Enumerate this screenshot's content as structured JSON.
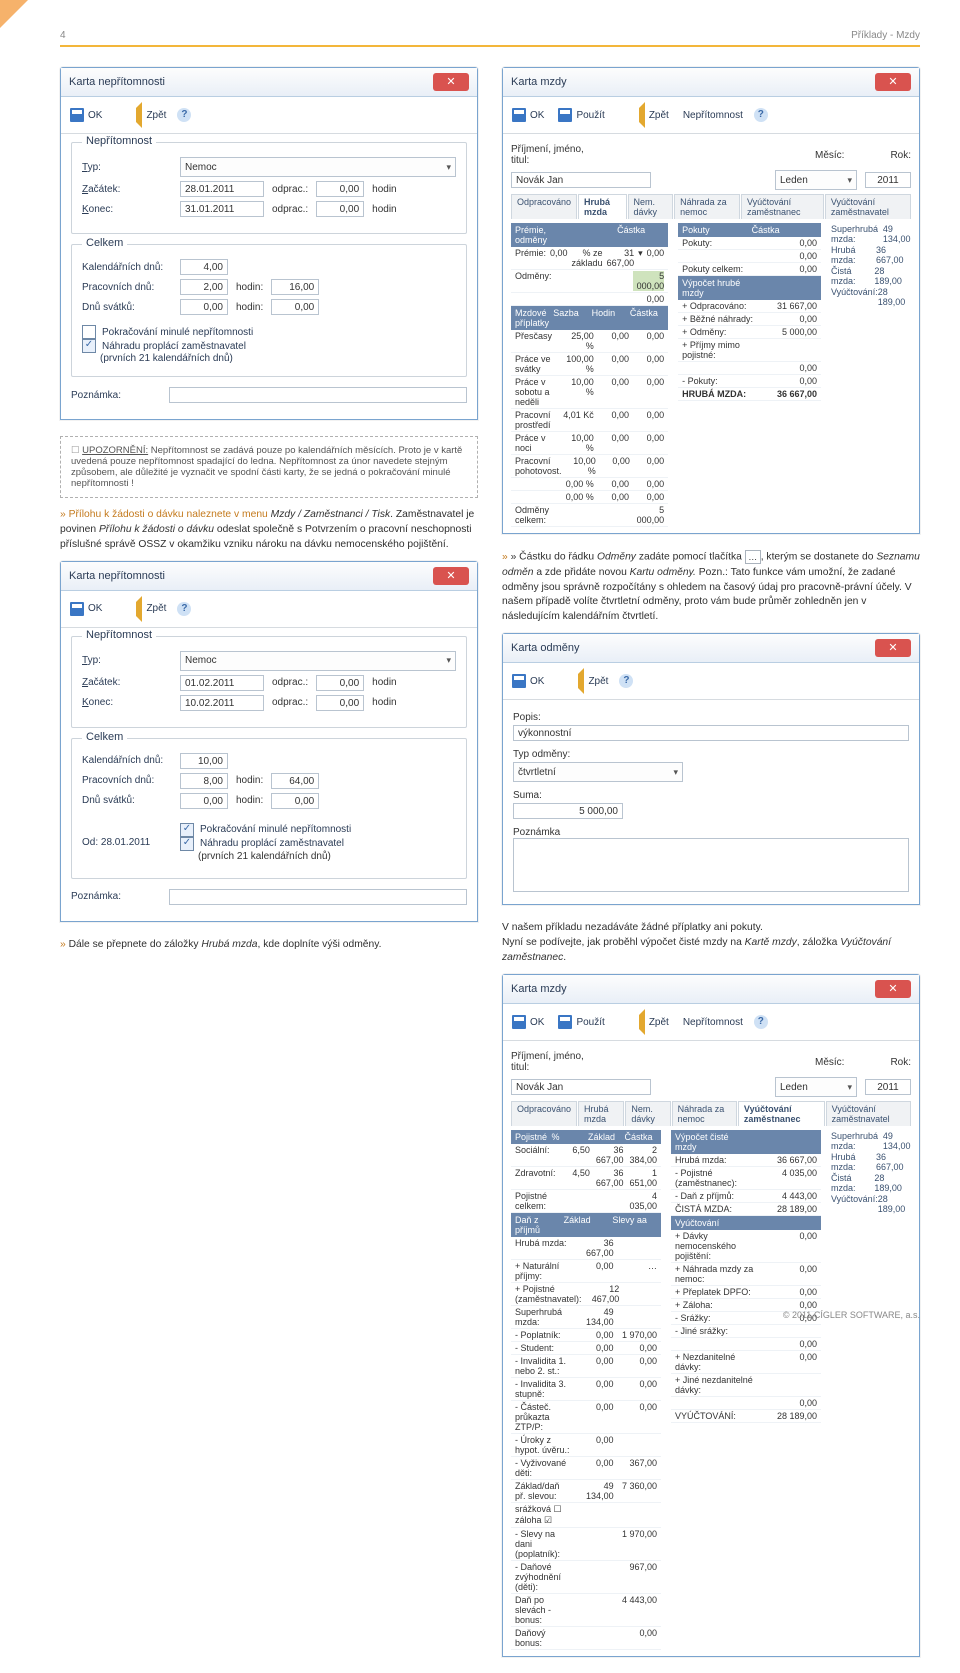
{
  "page": {
    "number": "4",
    "header_right": "Příklady - Mzdy"
  },
  "buttons": {
    "ok": "OK",
    "zpet": "Zpět",
    "pouzit": "Použít",
    "nepritomnost": "Nepřítomnost",
    "help": "?"
  },
  "win1": {
    "title": "Karta nepřítomnosti",
    "group1": "Nepřítomnost",
    "typ_label": "Typ:",
    "typ_value": "Nemoc",
    "zacatek_label": "Začátek:",
    "zacatek": "28.01.2011",
    "odprac": "odprac.:",
    "zacatek_h": "0,00",
    "hodin": "hodin",
    "konec_label": "Konec:",
    "konec": "31.01.2011",
    "konec_h": "0,00",
    "group2": "Celkem",
    "kaldnu_l": "Kalendářních dnů:",
    "kaldnu": "4,00",
    "pracdnu_l": "Pracovních dnů:",
    "pracdnu": "2,00",
    "hodin_l": "hodin:",
    "prach": "16,00",
    "svatku_l": "Dnů svátků:",
    "svatku": "0,00",
    "svh": "0,00",
    "chk1": "Pokračování minulé nepřítomnosti",
    "chk2": "Náhradu proplácí zaměstnavatel",
    "chk2_note": "(prvních 21 kalendářních dnů)",
    "poznamka_l": "Poznámka:"
  },
  "win2": {
    "title": "Karta nepřítomnosti",
    "zacatek": "01.02.2011",
    "konec": "10.02.2011",
    "zacatek_h": "0,00",
    "konec_h": "0,00",
    "kaldnu": "10,00",
    "pracdnu": "8,00",
    "prach": "64,00",
    "svatku": "0,00",
    "svh": "0,00",
    "od_l": "Od: 28.01.2011"
  },
  "body": {
    "upo_lead": "UPOZORNĚNÍ:",
    "upo_rest": " Nepřítomnost se zadává pouze po kalendářních měsících. Proto je v kartě uvedená pouze nepřítomnost spadající do ledna. Nepřítomnost za únor navedete stejným způsobem, ale důležité je vyznačit ve spodní části karty, že se jedná o ",
    "upo_link": "pokračování minulé nepřítomnosti",
    "upo_tail": "!",
    "para1a": "» Přílohu k žádosti o dávku naleznete v menu ",
    "para1b": "Mzdy / Zaměstnanci / Tisk",
    "para1c": ". Zaměstnavatel je povinen ",
    "para1d": "Přílohu k žádosti o dávku",
    "para1e": " odeslat společně s Potvrzením o pracovní neschopnosti příslušné správě OSSZ v okamžiku vzniku nároku na dávku nemocenského pojištění.",
    "para2": "» Dále se přepnete do záložky Hrubá mzda, kde doplníte výši odměny.",
    "para3a": "» Částku do řádku ",
    "para3b": "Odměny",
    "para3c": " zadáte pomocí tlačítka ",
    "para3d": ", kterým se dostanete do ",
    "para3e": "Seznamu odměn",
    "para3f": " a zde přidáte novou ",
    "para3g": "Kartu odměny.",
    "para3h": " Pozn.: Tato funkce vám umožní, že zadané odměny jsou správně rozpočítány s ohledem na časový údaj pro pracovně-právní účely. V našem případě volíte čtvrtletní odměny, proto vám bude průměr zohledněn jen v následujícím kalendářním čtvrtletí.",
    "para4a": "V našem příkladu nezadáváte žádné příplatky ani pokuty.",
    "para4b": "Nyní se podívejte, jak proběhl výpočet čisté mzdy na ",
    "para4c": "Kartě mzdy",
    "para4d": ", záložka ",
    "para4e": "Vyúčtování zaměstnanec",
    "para4f": "."
  },
  "mzdy1": {
    "title": "Karta mzdy",
    "name_l": "Příjmení, jméno, titul:",
    "name": "Novák Jan",
    "mesic_l": "Měsíc:",
    "mesic": "Leden",
    "rok_l": "Rok:",
    "rok": "2011",
    "tabs": [
      "Odpracováno",
      "Hrubá mzda",
      "Nem. dávky",
      "Náhrada za nemoc",
      "Vyúčtování zaměstnanec",
      "Vyúčtování zaměstnavatel"
    ],
    "premie_hdr": [
      "Prémie, odměny",
      "",
      "",
      "Částka"
    ],
    "premie": "Prémie:",
    "premie_pct": "0,00",
    "premie_ze": "% ze základu",
    "premie_base": "31 667,00",
    "premie_val": "0,00",
    "odmeny_l": "Odměny:",
    "odmeny": "5 000,00",
    "odmeny2": "0,00",
    "pokuty_hdr": [
      "Pokuty",
      "",
      "Částka"
    ],
    "pokuty_l": "Pokuty:",
    "pokuty": "0,00",
    "pokuty_celkem_l": "Pokuty celkem:",
    "pokuty_celkem": "0,00",
    "pripl_hdr": [
      "Mzdové příplatky",
      "Sazba",
      "Hodin",
      "Částka"
    ],
    "pripl": [
      [
        "Přesčasy",
        "25,00 %",
        "0,00",
        "0,00"
      ],
      [
        "Práce ve svátky",
        "100,00 %",
        "0,00",
        "0,00"
      ],
      [
        "Práce v sobotu a neděli",
        "10,00 %",
        "0,00",
        "0,00"
      ],
      [
        "Pracovní prostředí",
        "4,01 Kč",
        "0,00",
        "0,00"
      ],
      [
        "Práce v noci",
        "10,00 %",
        "0,00",
        "0,00"
      ],
      [
        "Pracovní pohotovost.",
        "10,00 %",
        "0,00",
        "0,00"
      ],
      [
        "",
        "0,00 %",
        "0,00",
        "0,00"
      ],
      [
        "",
        "0,00 %",
        "0,00",
        "0,00"
      ]
    ],
    "odmeny_celkem_l": "Odměny celkem:",
    "odmeny_celkem": "5 000,00",
    "vypocet_hdr": "Výpočet hrubé mzdy",
    "vypocet": [
      [
        "+ Odpracováno:",
        "31 667,00"
      ],
      [
        "+ Běžné náhrady:",
        "0,00"
      ],
      [
        "+ Odměny:",
        "5 000,00"
      ],
      [
        "+ Příjmy mimo pojistné:",
        ""
      ],
      [
        "",
        "0,00"
      ],
      [
        "- Pokuty:",
        "0,00"
      ]
    ],
    "hruba_l": "HRUBÁ MZDA:",
    "hruba": "36 667,00",
    "side": [
      [
        "Superhrubá mzda:",
        "49 134,00"
      ],
      [
        "Hrubá mzda:",
        "36 667,00"
      ],
      [
        "Čistá mzda:",
        "28 189,00"
      ],
      [
        "Vyúčtování:",
        "28 189,00"
      ]
    ]
  },
  "odmena": {
    "title": "Karta odměny",
    "popis_l": "Popis:",
    "popis": "výkonnostní",
    "typ_l": "Typ odměny:",
    "typ": "čtvrtletní",
    "suma_l": "Suma:",
    "suma": "5 000,00",
    "pozn_l": "Poznámka"
  },
  "mzdy2": {
    "title": "Karta mzdy",
    "tabs": [
      "Odpracováno",
      "Hrubá mzda",
      "Nem. dávky",
      "Náhrada za nemoc",
      "Vyúčtování zaměstnanec",
      "Vyúčtování zaměstnavatel"
    ],
    "poj_hdr": [
      "Pojistné",
      "%",
      "Základ",
      "Částka"
    ],
    "poj": [
      [
        "Sociální:",
        "6,50",
        "36 667,00",
        "2 384,00"
      ],
      [
        "Zdravotní:",
        "4,50",
        "36 667,00",
        "1 651,00"
      ]
    ],
    "poj_celkem_l": "Pojistné celkem:",
    "poj_celkem": "4 035,00",
    "dan_hdr": [
      "Daň z příjmů",
      "Základ",
      "Slevy aa"
    ],
    "dan": [
      [
        "Hrubá mzda:",
        "36 667,00",
        ""
      ],
      [
        "+ Naturální příjmy:",
        "0,00",
        "…"
      ],
      [
        "+ Pojistné (zaměstnavatel):",
        "12 467,00",
        ""
      ],
      [
        "Superhrubá mzda:",
        "49 134,00",
        ""
      ],
      [
        "- Poplatník:",
        "0,00",
        "1 970,00"
      ],
      [
        "- Student:",
        "0,00",
        "0,00"
      ],
      [
        "- Invalidita 1. nebo 2. st.:",
        "0,00",
        "0,00"
      ],
      [
        "- Invalidita 3. stupně:",
        "0,00",
        "0,00"
      ],
      [
        "- Částeč. průkazta ZTP/P:",
        "0,00",
        "0,00"
      ],
      [
        "- Úroky z hypot. úvěru.:",
        "0,00",
        ""
      ],
      [
        "- Vyživované děti:",
        "0,00",
        "367,00"
      ],
      [
        "Základ/daň př. slevou:",
        "49 134,00",
        "7 360,00"
      ],
      [
        "srážková ☐ záloha ☑",
        "",
        ""
      ],
      [
        "- Slevy na dani (poplatník):",
        "",
        "1 970,00"
      ],
      [
        "- Daňové zvýhodnění (děti):",
        "",
        "967,00"
      ],
      [
        "Daň po slevách - bonus:",
        "",
        "4 443,00"
      ],
      [
        "Daňový bonus:",
        "",
        "0,00"
      ]
    ],
    "cm_hdr": "Výpočet čisté mzdy",
    "cm": [
      [
        "Hrubá mzda:",
        "36 667,00"
      ],
      [
        "- Pojistné (zaměstnanec):",
        "4 035,00"
      ],
      [
        "- Daň z příjmů:",
        "4 443,00"
      ],
      [
        "ČISTÁ MZDA:",
        "28 189,00"
      ]
    ],
    "vy_hdr": "Vyúčtování",
    "vy": [
      [
        "+ Dávky nemocenského pojištění:",
        "0,00"
      ],
      [
        "+ Náhrada mzdy za nemoc:",
        "0,00"
      ],
      [
        "+ Přeplatek DPFO:",
        "0,00"
      ],
      [
        "+ Záloha:",
        "0,00"
      ],
      [
        "- Srážky:",
        "0,00"
      ],
      [
        "- Jiné srážky:",
        ""
      ],
      [
        "",
        "0,00"
      ],
      [
        "+ Nezdanitelné dávky:",
        "0,00"
      ],
      [
        "+ Jiné nezdanitelné dávky:",
        ""
      ],
      [
        "",
        "0,00"
      ],
      [
        "VYÚČTOVÁNÍ:",
        "28 189,00"
      ]
    ],
    "side": [
      [
        "Superhrubá mzda:",
        "49 134,00"
      ],
      [
        "Hrubá mzda:",
        "36 667,00"
      ],
      [
        "Čistá mzda:",
        "28 189,00"
      ],
      [
        "Vyúčtování:",
        "28 189,00"
      ]
    ],
    "slevy_btn": "Slevy aa",
    "name": "Novák Jan",
    "mesic": "Leden",
    "rok": "2011"
  },
  "footer": "© 2011 CÍGLER SOFTWARE, a.s."
}
